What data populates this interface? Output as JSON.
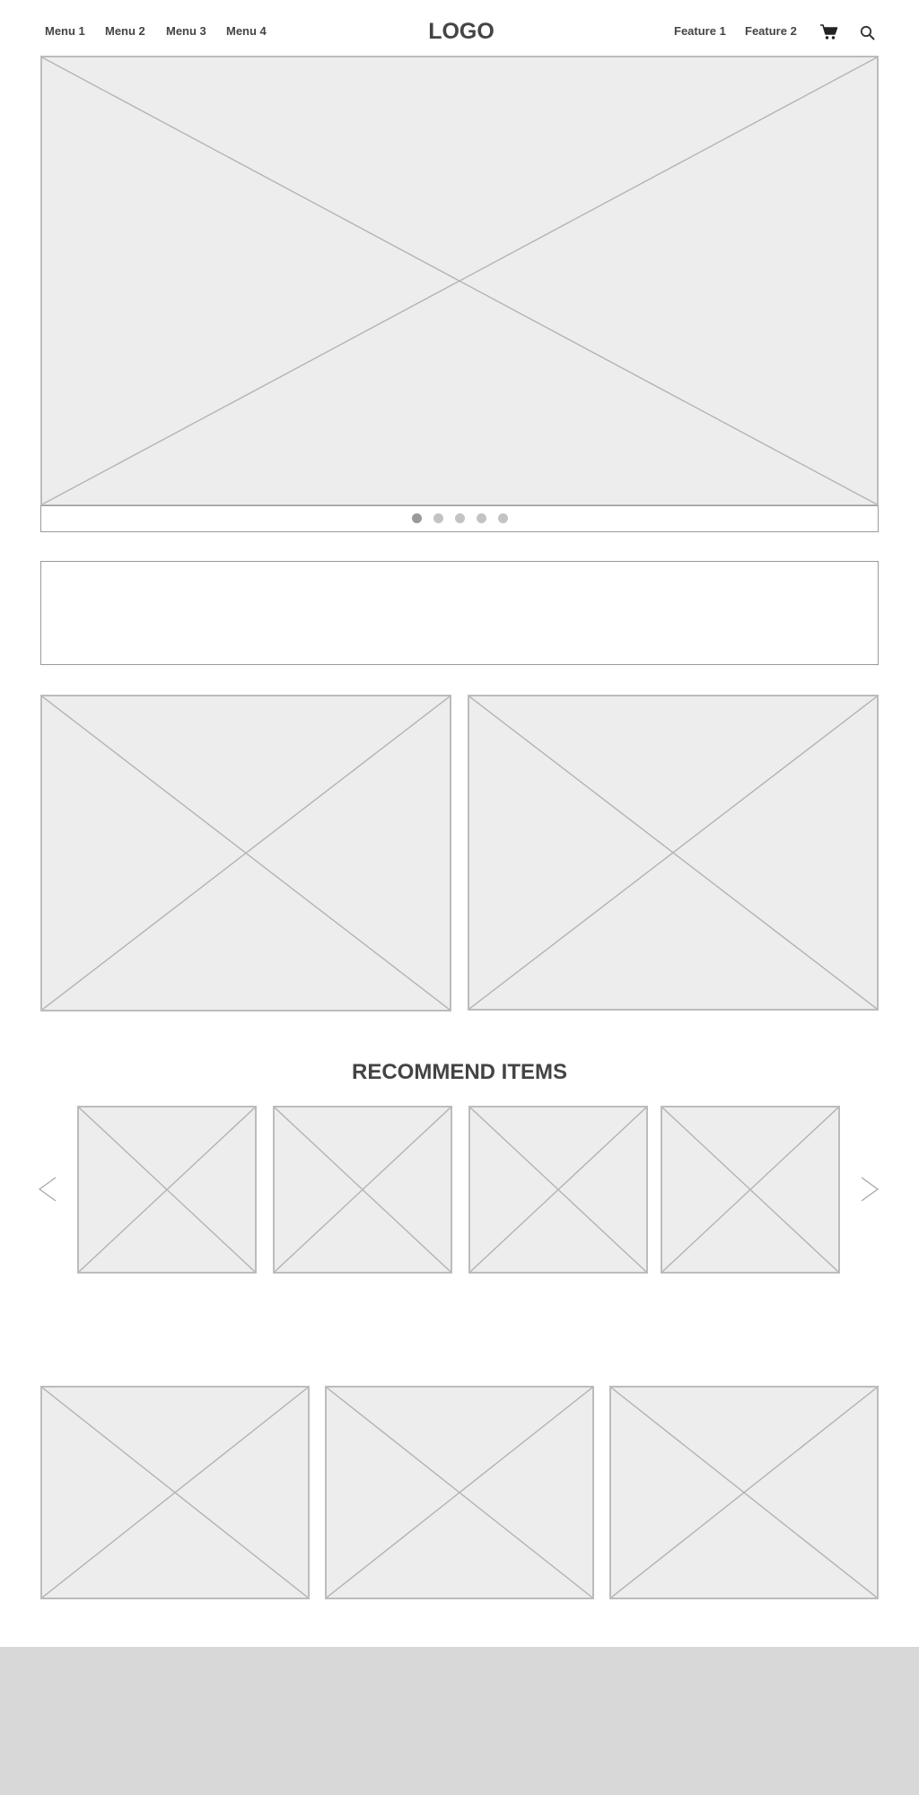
{
  "header": {
    "menu": [
      {
        "label": "Menu 1"
      },
      {
        "label": "Menu 2"
      },
      {
        "label": "Menu 3"
      },
      {
        "label": "Menu 4"
      }
    ],
    "logo": "LOGO",
    "features": [
      {
        "label": "Feature 1"
      },
      {
        "label": "Feature 2"
      }
    ],
    "icons": {
      "cart": "cart-icon",
      "search": "search-icon"
    }
  },
  "carousel": {
    "slide_count": 5,
    "active_index": 0
  },
  "recommend": {
    "title": "RECOMMEND ITEMS"
  },
  "colors": {
    "text": "#444444",
    "placeholder_fill": "#ededed",
    "placeholder_stroke": "#bcbcbc",
    "dot_inactive": "#c3c3c3",
    "dot_active": "#9a9a9a",
    "footer": "#d8d8d8"
  }
}
